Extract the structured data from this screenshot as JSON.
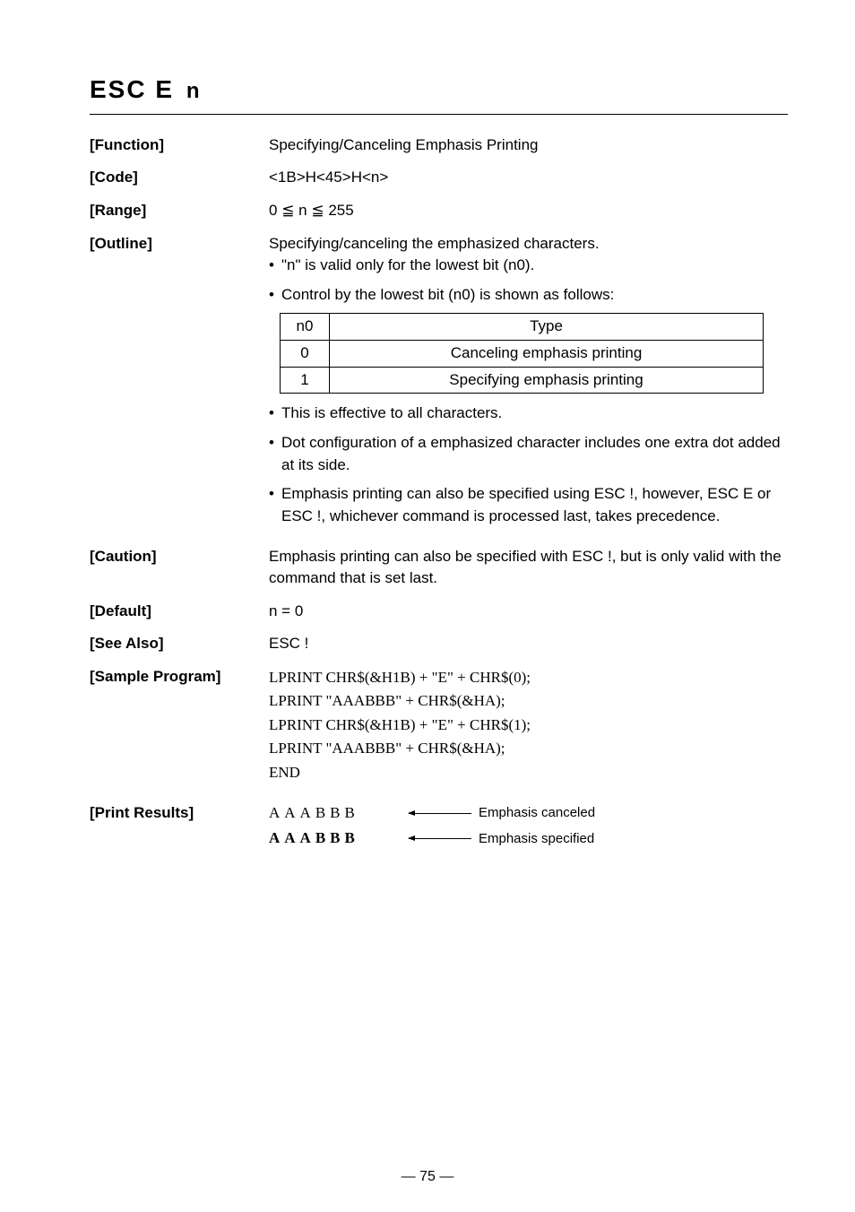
{
  "title_main": "ESC  E",
  "title_sub": "n",
  "sections": {
    "function": {
      "label": "[Function]",
      "value": "Specifying/Canceling Emphasis Printing"
    },
    "code": {
      "label": "[Code]",
      "value": "<1B>H<45>H<n>"
    },
    "range": {
      "label": "[Range]",
      "value_pre": "0 ",
      "value_mid1": "≦",
      "value_n": " n ",
      "value_mid2": "≦",
      "value_post": " 255"
    },
    "outline": {
      "label": "[Outline]",
      "line1": "Specifying/canceling the emphasized characters.",
      "bullet1": "\"n\" is valid only for the lowest bit (n0).",
      "bullet2": "Control by the lowest bit (n0) is shown as follows:",
      "table": {
        "headers": [
          "n0",
          "Type"
        ],
        "rows": [
          [
            "0",
            "Canceling emphasis printing"
          ],
          [
            "1",
            "Specifying emphasis printing"
          ]
        ]
      },
      "bullet3": "This is effective to all characters.",
      "bullet4": "Dot configuration of a emphasized character includes one extra dot added at its side.",
      "bullet5": "Emphasis printing can also be specified using ESC !, however, ESC E or ESC !, whichever command is processed last, takes precedence."
    },
    "caution": {
      "label": "[Caution]",
      "value": "Emphasis printing can also be specified with ESC !, but is only valid with the command that is set last."
    },
    "default": {
      "label": "[Default]",
      "value": "n = 0"
    },
    "see_also": {
      "label": "[See Also]",
      "value": "ESC !"
    },
    "sample": {
      "label": "[Sample Program]",
      "lines": [
        "LPRINT CHR$(&H1B) + \"E\" + CHR$(0);",
        "LPRINT \"AAABBB\" + CHR$(&HA);",
        "LPRINT CHR$(&H1B) + \"E\" + CHR$(1);",
        "LPRINT \"AAABBB\" + CHR$(&HA);",
        "END"
      ]
    },
    "print_results": {
      "label": "[Print Results]",
      "rows": [
        {
          "sample": "AAABBB",
          "bold": false,
          "desc": "Emphasis canceled"
        },
        {
          "sample": "AAABBB",
          "bold": true,
          "desc": "Emphasis specified"
        }
      ]
    }
  },
  "page_number": "— 75 —"
}
